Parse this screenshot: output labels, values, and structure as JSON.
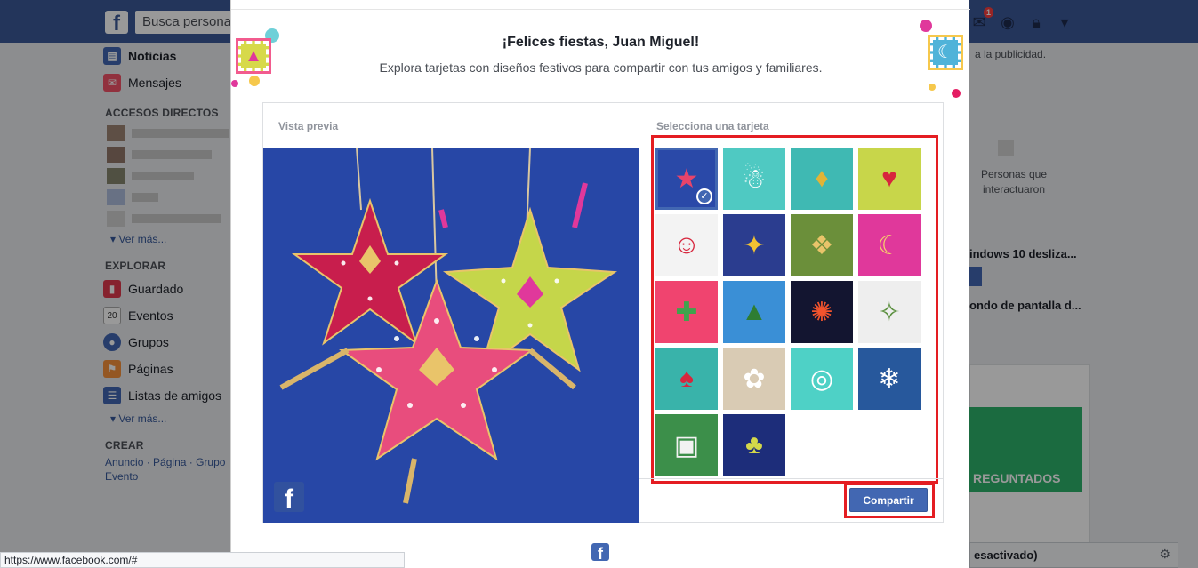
{
  "topbar": {
    "logo": "f",
    "search_placeholder": "Busca personas",
    "notification_count": "1"
  },
  "sidebar": {
    "main_items": [
      {
        "label": "Noticias",
        "icon": "news-feed-icon"
      },
      {
        "label": "Mensajes",
        "icon": "messages-icon"
      }
    ],
    "shortcuts_heading": "ACCESOS DIRECTOS",
    "shortcuts_more": "Ver más...",
    "explore_heading": "EXPLORAR",
    "explore_items": [
      {
        "label": "Guardado",
        "icon": "bookmark-icon",
        "color": "#e0394d"
      },
      {
        "label": "Eventos",
        "icon": "calendar-icon",
        "color": "#e0394d",
        "icon_text": "20"
      },
      {
        "label": "Grupos",
        "icon": "groups-icon",
        "color": "#4267b2"
      },
      {
        "label": "Páginas",
        "icon": "flag-icon",
        "color": "#f7923b"
      },
      {
        "label": "Listas de amigos",
        "icon": "friends-list-icon",
        "color": "#4267b2"
      }
    ],
    "explore_more": "Ver más...",
    "create_heading": "CREAR",
    "create_links": [
      "Anuncio",
      "Página",
      "Grupo",
      "Evento"
    ]
  },
  "rightcol": {
    "ad_text": "a la publicidad.",
    "people_label": "Personas que interactuaron",
    "news1": "indows 10 desliza...",
    "news2": "ondo de pantalla d...",
    "game_label": "REGUNTADOS",
    "chat_label": "esactivado)"
  },
  "status_bar": {
    "url": "https://www.facebook.com/#"
  },
  "modal": {
    "title": "¡Felices fiestas, Juan Miguel!",
    "subtitle": "Explora tarjetas con diseños festivos para compartir con tus amigos y familiares.",
    "preview_label": "Vista previa",
    "select_label": "Selecciona una tarjeta",
    "share_button": "Compartir",
    "cards": [
      {
        "name": "card-paper-stars",
        "bg": "#2a49a8",
        "glyph": "★",
        "fg": "#e8446a",
        "selected": true
      },
      {
        "name": "card-snow-globe",
        "bg": "#4fc9c2",
        "glyph": "☃",
        "fg": "#ffffff"
      },
      {
        "name": "card-dreidel-coins",
        "bg": "#3fb9b3",
        "glyph": "♦",
        "fg": "#e0b437"
      },
      {
        "name": "card-bird",
        "bg": "#c8d64a",
        "glyph": "♥",
        "fg": "#d7263d"
      },
      {
        "name": "card-santa",
        "bg": "#f3f3f3",
        "glyph": "☺",
        "fg": "#d7263d"
      },
      {
        "name": "card-gifts-sparkler",
        "bg": "#2b3d8f",
        "glyph": "✦",
        "fg": "#f1c232"
      },
      {
        "name": "card-pattern-knot",
        "bg": "#6b8f3a",
        "glyph": "❖",
        "fg": "#e9c46a"
      },
      {
        "name": "card-crescent-window",
        "bg": "#e0389b",
        "glyph": "☾",
        "fg": "#f6d36b"
      },
      {
        "name": "card-cactus",
        "bg": "#f0446f",
        "glyph": "✚",
        "fg": "#3fa34d"
      },
      {
        "name": "card-tree-ornaments",
        "bg": "#3a8fd6",
        "glyph": "▲",
        "fg": "#2e7d32"
      },
      {
        "name": "card-fireworks",
        "bg": "#131530",
        "glyph": "✺",
        "fg": "#f2542d"
      },
      {
        "name": "card-angel-leaves",
        "bg": "#eeeeee",
        "glyph": "✧",
        "fg": "#5a8f3e"
      },
      {
        "name": "card-stockings",
        "bg": "#39b3aa",
        "glyph": "♠",
        "fg": "#d7263d"
      },
      {
        "name": "card-sand-angel",
        "bg": "#d9cbb4",
        "glyph": "✿",
        "fg": "#ffffff"
      },
      {
        "name": "card-latte-art",
        "bg": "#4ed1c6",
        "glyph": "◎",
        "fg": "#ffffff"
      },
      {
        "name": "card-string-lights",
        "bg": "#27589c",
        "glyph": "❄",
        "fg": "#ffffff"
      },
      {
        "name": "card-camper-van",
        "bg": "#3c8f4a",
        "glyph": "▣",
        "fg": "#f2f2f2"
      },
      {
        "name": "card-forest",
        "bg": "#1d2d7a",
        "glyph": "♣",
        "fg": "#d4d84a"
      }
    ]
  }
}
